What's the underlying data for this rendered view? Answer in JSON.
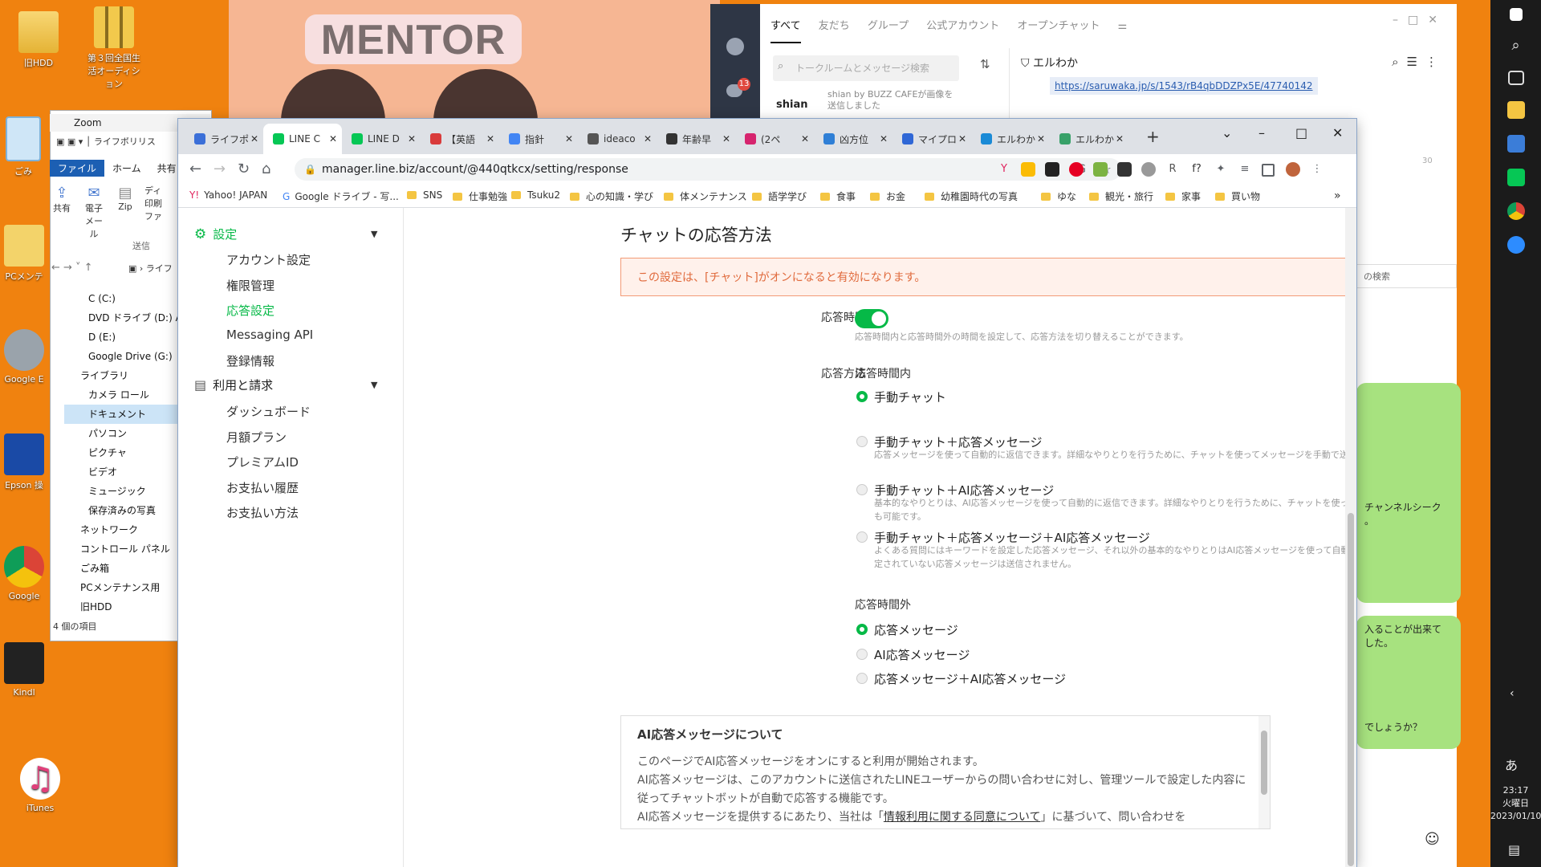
{
  "desktop": {
    "icons": [
      {
        "label": "旧HDD"
      },
      {
        "label": "第３回全国生活オーディション"
      },
      {
        "label": "ごみ"
      },
      {
        "label": "PCメンテ"
      },
      {
        "label": "Google E"
      },
      {
        "label": "Epson 操"
      },
      {
        "label": "Google"
      },
      {
        "label": "Kindl"
      },
      {
        "label": "iTunes"
      }
    ]
  },
  "thumbnail": {
    "title": "MENTOR"
  },
  "line_app": {
    "tabs": [
      "すべて",
      "友だち",
      "グループ",
      "公式アカウント",
      "オープンチャット"
    ],
    "badge": "13",
    "search_placeholder": "トークルームとメッセージ検索",
    "chat_preview": {
      "name": "shian",
      "line1": "shian by BUZZ CAFEが画像を",
      "line2": "送信しました"
    },
    "chat_title": "エルわか",
    "chat_link": "https://saruwaka.jp/s/1543/rB4qbDDZPx5E/47740142",
    "side_search": "の検索",
    "bubble1": "チャンネルシーク",
    "bubble1b": "。",
    "bubble2a": "入ることが出来て",
    "bubble2b": "した。",
    "bubble3": "でしょうか？",
    "time_fragment": "30"
  },
  "explorer": {
    "zoom_title": "Zoom",
    "path_fragment": "ライフボリリス",
    "ribbon_tabs": [
      "ファイル",
      "ホーム",
      "共有"
    ],
    "ribbon_buttons": [
      "共有",
      "電子メール",
      "Zip"
    ],
    "ribbon_small": [
      "ディ",
      "印刷",
      "ファ"
    ],
    "ribbon_group": "送信",
    "address": "ライフ",
    "tree": [
      {
        "label": "C (C:)"
      },
      {
        "label": "DVD ドライブ (D:) Audi"
      },
      {
        "label": "D (E:)"
      },
      {
        "label": "Google Drive (G:)"
      },
      {
        "label": "ライブラリ"
      },
      {
        "label": "カメラ ロール"
      },
      {
        "label": "ドキュメント"
      },
      {
        "label": "パソコン"
      },
      {
        "label": "ピクチャ"
      },
      {
        "label": "ビデオ"
      },
      {
        "label": "ミュージック"
      },
      {
        "label": "保存済みの写真"
      },
      {
        "label": "ネットワーク"
      },
      {
        "label": "コントロール パネル"
      },
      {
        "label": "ごみ箱"
      },
      {
        "label": "PCメンテナンス用"
      },
      {
        "label": "旧HDD"
      }
    ],
    "status": "4 個の項目"
  },
  "browser": {
    "tabs": [
      {
        "label": "ライフポ",
        "color": "#3b6fd8"
      },
      {
        "label": "LINE C",
        "color": "#06c755"
      },
      {
        "label": "LINE D",
        "color": "#06c755"
      },
      {
        "label": "【英語",
        "color": "#d93b3b"
      },
      {
        "label": "指針",
        "color": "#4285f4"
      },
      {
        "label": "ideaco",
        "color": "#555555"
      },
      {
        "label": "年齢早",
        "color": "#333333"
      },
      {
        "label": "(2ペ",
        "color": "#d6246e"
      },
      {
        "label": "凶方位",
        "color": "#2f7fd6"
      },
      {
        "label": "マイプロ",
        "color": "#2f67d6"
      },
      {
        "label": "エルわか",
        "color": "#1a8ad6"
      },
      {
        "label": "エルわか",
        "color": "#38a169"
      }
    ],
    "new_tab": "+",
    "url": "manager.line.biz/account/@440qtkcx/setting/response",
    "bookmarks": [
      "Yahoo! JAPAN",
      "Google ドライブ - 写...",
      "SNS",
      "仕事勉強",
      "Tsuku2",
      "心の知識・学び",
      "体メンテナンス",
      "語学学び",
      "食事",
      "お金",
      "幼稚園時代の写真",
      "ゆな",
      "観光・旅行",
      "家事",
      "買い物"
    ]
  },
  "sidebar": {
    "settings_group": "設定",
    "settings_items": [
      "アカウント設定",
      "権限管理",
      "応答設定",
      "Messaging API",
      "登録情報"
    ],
    "billing_group": "利用と請求",
    "billing_items": [
      "ダッシュボード",
      "月額プラン",
      "プレミアムID",
      "お支払い履歴",
      "お支払い方法"
    ]
  },
  "page": {
    "title": "チャットの応答方法",
    "notice": "この設定は、[チャット]がオンになると有効になります。",
    "response_time_label": "応答時間",
    "response_time_on": true,
    "response_time_help": "応答時間内と応答時間外の時間を設定して、応答方法を切り替えることができます。",
    "method_label": "応答方法",
    "in_hours_label": "応答時間内",
    "in_hours_options": [
      {
        "label": "手動チャット",
        "desc": "",
        "selected": true
      },
      {
        "label": "手動チャット＋応答メッセージ",
        "desc": "応答メッセージを使って自動的に返信できます。詳細なやりとりを行うために、チャットを使ってメッセージを手動で送信することも可能です。",
        "selected": false
      },
      {
        "label": "手動チャット＋AI応答メッセージ",
        "desc": "基本的なやりとりは、AI応答メッセージを使って自動的に返信できます。詳細なやりとりを行うために、チャットを使ってメッセージを手動で送信することも可能です。",
        "selected": false
      },
      {
        "label": "手動チャット＋応答メッセージ＋AI応答メッセージ",
        "desc": "よくある質問にはキーワードを設定した応答メッセージ、それ以外の基本的なやりとりはAI応答メッセージを使って自動的に返信できます。キーワードが設定されていない応答メッセージは送信されません。",
        "selected": false
      }
    ],
    "off_hours_label": "応答時間外",
    "off_hours_options": [
      {
        "label": "応答メッセージ",
        "selected": true
      },
      {
        "label": "AI応答メッセージ",
        "selected": false
      },
      {
        "label": "応答メッセージ＋AI応答メッセージ",
        "selected": false
      }
    ],
    "ai_box": {
      "title": "AI応答メッセージについて",
      "p1": "このページでAI応答メッセージをオンにすると利用が開始されます。",
      "p2": "AI応答メッセージは、このアカウントに送信されたLINEユーザーからの問い合わせに対し、管理ツールで設定した内容に従ってチャットボットが自動で応答する機能です。",
      "p3a": "AI応答メッセージを提供するにあたり、当社は「",
      "p3link": "情報利用に関する同意について",
      "p3b": "」に基づいて、問い合わせを"
    }
  },
  "taskbar": {
    "clock_time": "23:17",
    "clock_day": "火曜日",
    "clock_date": "2023/01/10",
    "ime": "あ"
  }
}
